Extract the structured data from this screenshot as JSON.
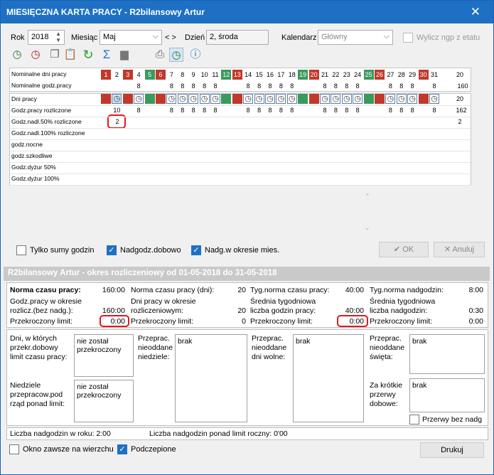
{
  "title": "MIESIĘCZNA KARTA PRACY - R2bilansowy Artur",
  "top": {
    "rok_label": "Rok",
    "rok": "2018",
    "miesiac_label": "Miesiąc",
    "miesiac": "Maj",
    "nav": "< >",
    "dzien_label": "Dzień",
    "dzien": "2, środa",
    "kalendarz_label": "Kalendarz",
    "kalendarz": "Główny",
    "wylicz": "Wylicz ngp z etatu"
  },
  "toolbar_icons": [
    "add-clock-icon",
    "remove-clock-icon",
    "copy-icon",
    "paste-icon",
    "refresh-icon",
    "sum-icon",
    "calendar-icon",
    "print-icon",
    "check-clock-icon",
    "info-icon"
  ],
  "grid": {
    "row1_label": "Nominalne dni pracy",
    "row2_label": "Nominalne godz.pracy",
    "days": [
      "1",
      "2",
      "3",
      "4",
      "5",
      "6",
      "7",
      "8",
      "9",
      "10",
      "11",
      "12",
      "13",
      "14",
      "15",
      "16",
      "17",
      "18",
      "19",
      "20",
      "21",
      "22",
      "23",
      "24",
      "25",
      "26",
      "27",
      "28",
      "29",
      "30",
      "31"
    ],
    "day_types": [
      "h",
      "w",
      "h",
      "w",
      "s",
      "h",
      "w",
      "w",
      "w",
      "w",
      "w",
      "s",
      "h",
      "w",
      "w",
      "w",
      "w",
      "w",
      "s",
      "h",
      "w",
      "w",
      "w",
      "w",
      "s",
      "h",
      "w",
      "w",
      "w",
      "h",
      "w"
    ],
    "nominal_hours": [
      "",
      "",
      "",
      "8",
      "",
      "",
      "8",
      "8",
      "8",
      "8",
      "8",
      "",
      "",
      "8",
      "8",
      "8",
      "8",
      "8",
      "",
      "",
      "8",
      "8",
      "8",
      "8",
      "",
      "",
      "8",
      "8",
      "8",
      "",
      "8"
    ],
    "total_days": "20",
    "total_hours": "160",
    "detail_rows": [
      "Dni pracy",
      "Godz.pracy rozliczone",
      "Godz.nadl.50% rozliczone",
      "Godz.nadl.100% rozliczone",
      "godz.nocne",
      "godz.szkodliwe",
      "Godz.dyżur 50%",
      "Godz.dyżur 100%"
    ],
    "worked_hours": [
      "",
      "10",
      "",
      "8",
      "",
      "",
      "8",
      "8",
      "8",
      "8",
      "8",
      "",
      "",
      "8",
      "8",
      "8",
      "8",
      "8",
      "",
      "",
      "8",
      "8",
      "8",
      "8",
      "",
      "",
      "8",
      "8",
      "8",
      "",
      "8"
    ],
    "overtime_50": "2",
    "dni_total": "20",
    "rozl_total": "162",
    "nadl_total": "2"
  },
  "options": {
    "tylko_sumy": "Tylko sumy godzin",
    "nadgodz_dobowo": "Nadgodz.dobowo",
    "nadg_okres": "Nadg.w okresie mies.",
    "ok": "OK",
    "anuluj": "Anuluj"
  },
  "section_title": "R2bilansowy Artur - okres rozliczeniowy od 01-05-2018 do 31-05-2018",
  "stats": {
    "c1": {
      "l1": "Norma czasu pracy:",
      "v1": "160:00",
      "l2": "Godz.pracy w okresie rozlicz.(bez nadg.):",
      "v2": "160:00",
      "l3": "Przekroczony limit:",
      "v3": "0:00"
    },
    "c2": {
      "l1": "Norma czasu pracy (dni):",
      "v1": "20",
      "l2": "Dni pracy w okresie rozliczeniowym:",
      "v2": "20",
      "l3": "Przekroczony limit:",
      "v3": "0"
    },
    "c3": {
      "l1": "Tyg.norma czasu pracy:",
      "v1": "40:00",
      "l2": "Średnia tygodniowa liczba godzin pracy:",
      "v2": "40:00",
      "l3": "Przekroczony limit:",
      "v3": "0:00"
    },
    "c4": {
      "l1": "Tyg.norma nadgodzin:",
      "v1": "8:00",
      "l2": "Średnia tygodniowa liczba nadgodzin:",
      "v2": "0:30",
      "l3": "Przekroczony limit:",
      "v3": "0:00"
    }
  },
  "limits": {
    "dni_label": "Dni, w których przekr.dobowy limit czasu pracy:",
    "dni_val": "nie został przekroczony",
    "niedziele_label": "Niedziele przepracow.pod rząd ponad limit:",
    "niedziele_val": "nie został przekroczony",
    "nieodd_niedz_label": "Przeprac. nieoddane niedziele:",
    "nieodd_niedz_val": "brak",
    "nieodd_wolne_label": "Przeprac. nieoddane dni wolne:",
    "nieodd_wolne_val": "brak",
    "nieodd_swieta_label": "Przeprac. nieoddane święta:",
    "nieodd_swieta_val": "brak",
    "przerwy_label": "Za krótkie przerwy dobowe:",
    "przerwy_val": "brak",
    "przerwy_bez": "Przerwy bez nadg"
  },
  "footer": {
    "rok": "Liczba nadgodzin w roku: 2:00",
    "limit": "Liczba nadgodzin ponad limit roczny: 0'00",
    "okno": "Okno zawsze na wierzchu",
    "podczepione": "Podczepione",
    "drukuj": "Drukuj"
  },
  "colors": {
    "holiday": "#c0392b",
    "saturday": "#3a9a5c",
    "title": "#1e70c4",
    "highlight": "#e8141c"
  }
}
